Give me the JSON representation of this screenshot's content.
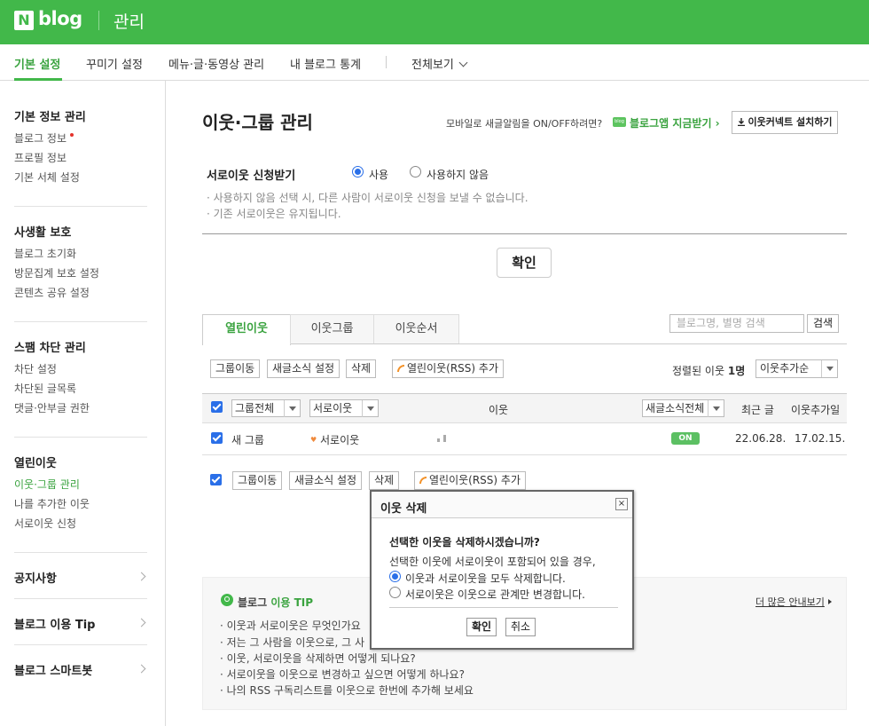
{
  "header": {
    "logo_n": "N",
    "logo_blog": "blog",
    "admin_label": "관리"
  },
  "nav": {
    "items": [
      "기본 설정",
      "꾸미기 설정",
      "메뉴·글·동영상 관리",
      "내 블로그 통계"
    ],
    "view_all": "전체보기"
  },
  "sidebar": {
    "sections": [
      {
        "title": "기본 정보 관리",
        "items": [
          "블로그 정보",
          "프로필 정보",
          "기본 서체 설정"
        ]
      },
      {
        "title": "사생활 보호",
        "items": [
          "블로그 초기화",
          "방문집계 보호 설정",
          "콘텐츠 공유 설정"
        ]
      },
      {
        "title": "스팸 차단 관리",
        "items": [
          "차단 설정",
          "차단된 글목록",
          "댓글·안부글 권한"
        ]
      },
      {
        "title": "열린이웃",
        "items": [
          "이웃·그룹 관리",
          "나를 추가한 이웃",
          "서로이웃 신청"
        ]
      }
    ],
    "links": [
      "공지사항",
      "블로그 이용 Tip",
      "블로그 스마트봇"
    ]
  },
  "main": {
    "title": "이웃·그룹 관리",
    "app_prompt": "모바일로 새글알림을 ON/OFF하려면?",
    "app_link": "블로그앱 지금받기",
    "app_badge": "blog",
    "install_button": "이웃커넥트 설치하기",
    "setting": {
      "label": "서로이웃 신청받기",
      "option_use": "사용",
      "option_not_use": "사용하지 않음",
      "desc1": "· 사용하지 않음 선택 시, 다른 사람이 서로이웃 신청을 보낼 수 없습니다.",
      "desc2": "· 기존 서로이웃은 유지됩니다."
    },
    "confirm_button": "확인",
    "tabs": [
      "열린이웃",
      "이웃그룹",
      "이웃순서"
    ],
    "search_placeholder": "블로그명, 별명 검색",
    "search_button": "검색",
    "toolbar": {
      "group_move": "그룹이동",
      "news_setting": "새글소식 설정",
      "delete": "삭제",
      "rss_add": "열린이웃(RSS) 추가",
      "sort_prefix": "정렬된 이웃",
      "sort_count": "1명",
      "sort_select": "이웃추가순"
    },
    "table": {
      "group_all": "그룹전체",
      "mutual": "서로이웃",
      "neighbor": "이웃",
      "news_all": "새글소식전체",
      "recent": "최근 글",
      "added": "이웃추가일",
      "rows": [
        {
          "group": "새 그룹",
          "type": "서로이웃",
          "news": "ON",
          "recent": "22.06.28.",
          "added": "17.02.15."
        }
      ]
    },
    "tip": {
      "title_prefix": "블로그",
      "title_suffix": "이용 TIP",
      "more": "더 많은 안내보기",
      "items": [
        "· 이웃과 서로이웃은 무엇인가요",
        "· 저는 그 사람을 이웃으로, 그 사",
        "· 이웃, 서로이웃을 삭제하면 어떻게 되나요?",
        "· 서로이웃을 이웃으로 변경하고 싶으면 어떻게 하나요?",
        "· 나의 RSS 구독리스트를 이웃으로 한번에 추가해 보세요"
      ]
    }
  },
  "dialog": {
    "title": "이웃 삭제",
    "close": "×",
    "question": "선택한 이웃을 삭제하시겠습니까?",
    "text": "선택한 이웃에 서로이웃이 포함되어 있을 경우,",
    "option1": "이웃과 서로이웃을 모두 삭제합니다.",
    "option2": "서로이웃은 이웃으로 관계만 변경합니다.",
    "ok": "확인",
    "cancel": "취소"
  }
}
